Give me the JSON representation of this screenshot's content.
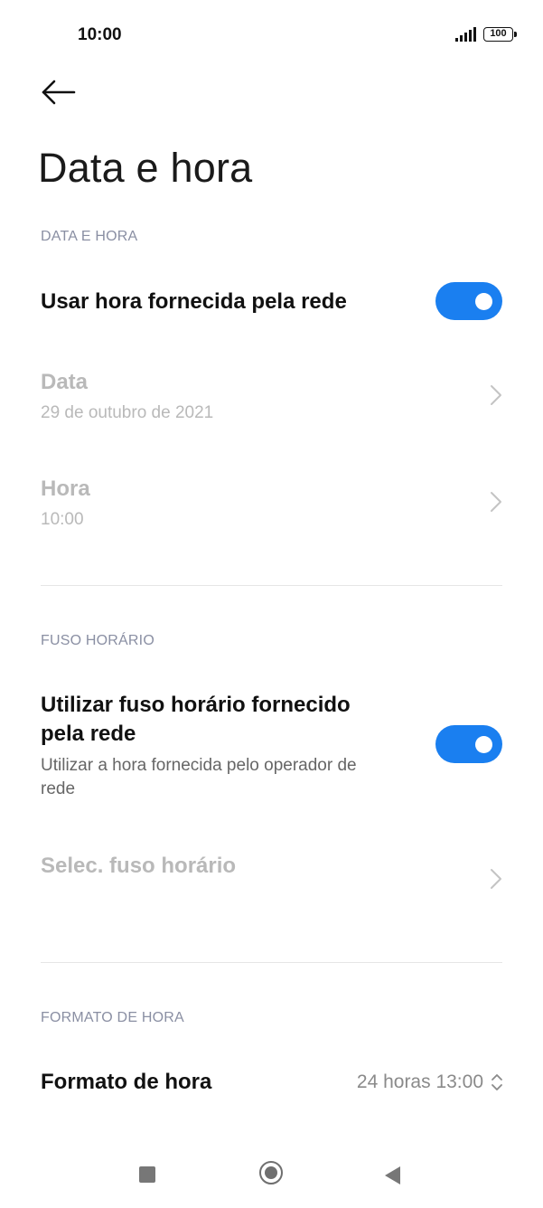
{
  "status_bar": {
    "time": "10:00",
    "battery": "100"
  },
  "header": {
    "title": "Data e hora"
  },
  "section_date_time": {
    "heading": "DATA E HORA",
    "network_time": {
      "label": "Usar hora fornecida pela rede",
      "enabled": true
    },
    "date": {
      "label": "Data",
      "value": "29 de outubro de 2021"
    },
    "time": {
      "label": "Hora",
      "value": "10:00"
    }
  },
  "section_timezone": {
    "heading": "FUSO HORÁRIO",
    "network_timezone": {
      "label_line1": "Utilizar fuso horário fornecido",
      "label_line2": "pela rede",
      "desc_line1": "Utilizar a hora fornecida pelo operador de",
      "desc_line2": "rede",
      "enabled": true
    },
    "select_timezone": {
      "label": "Selec. fuso horário"
    }
  },
  "section_format": {
    "heading": "FORMATO DE HORA",
    "time_format": {
      "label": "Formato de hora",
      "value": "24 horas 13:00"
    }
  },
  "colors": {
    "accent": "#1a7ff0",
    "section_heading": "#8a8fa3",
    "disabled_text": "#b9b9b9"
  },
  "nav_bar": {
    "icons": [
      "recents-square-icon",
      "home-circle-icon",
      "back-triangle-icon"
    ]
  }
}
